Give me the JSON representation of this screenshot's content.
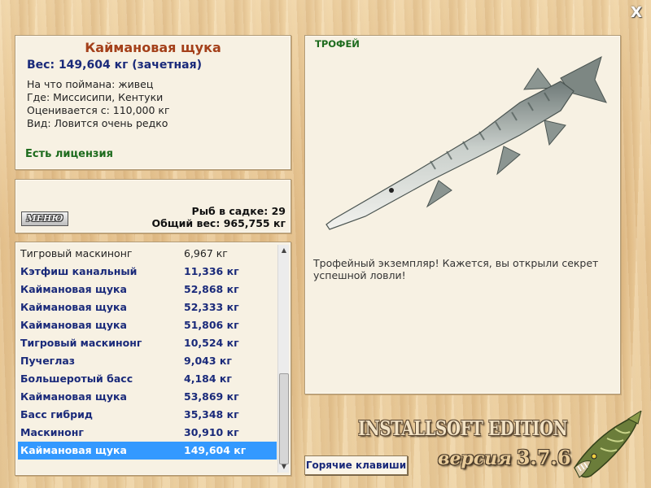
{
  "window": {
    "close_label": "X"
  },
  "fish_info": {
    "title": "Каймановая щука",
    "weight": "Вес: 149,604 кг (зачетная)",
    "bait": "На что поймана: живец",
    "location": "Где: Миссисипи, Кентуки",
    "valued_from": "Оценивается с: 110,000 кг",
    "rarity": "Вид: Ловится очень редко",
    "license": "Есть лицензия"
  },
  "menu_panel": {
    "menu_label": "МЕНЮ",
    "fish_in_cage": "Рыб в садке: 29",
    "total_weight": "Общий вес: 965,755 кг"
  },
  "catch_list": [
    {
      "name": "Тигровый маскинонг",
      "weight": "6,967 кг",
      "style": "plain"
    },
    {
      "name": "Кэтфиш канальный",
      "weight": "11,336 кг",
      "style": "bold"
    },
    {
      "name": "Каймановая щука",
      "weight": "52,868 кг",
      "style": "bold"
    },
    {
      "name": "Каймановая щука",
      "weight": "52,333 кг",
      "style": "bold"
    },
    {
      "name": "Каймановая щука",
      "weight": "51,806 кг",
      "style": "bold"
    },
    {
      "name": "Тигровый маскинонг",
      "weight": "10,524 кг",
      "style": "bold"
    },
    {
      "name": "Пучеглаз",
      "weight": "9,043 кг",
      "style": "bold"
    },
    {
      "name": "Большеротый басс",
      "weight": "4,184 кг",
      "style": "bold"
    },
    {
      "name": "Каймановая щука",
      "weight": "53,869 кг",
      "style": "bold"
    },
    {
      "name": "Басс гибрид",
      "weight": "35,348 кг",
      "style": "bold"
    },
    {
      "name": "Маскинонг",
      "weight": "30,910 кг",
      "style": "bold"
    },
    {
      "name": "Каймановая щука",
      "weight": "149,604 кг",
      "style": "selected"
    }
  ],
  "trophy": {
    "label": "ТРОФЕЙ",
    "description": "Трофейный экземпляр! Кажется, вы открыли секрет успешной ловли!"
  },
  "footer": {
    "hotkeys_label": "Горячие клавиши",
    "brand": "INSTALLSOFT EDITION",
    "version_word": "версия",
    "version_number": "3.7.6"
  },
  "colors": {
    "title": "#a4401a",
    "weight": "#1a2a7a",
    "license": "#1d6b1d",
    "selected_row": "#3399ff",
    "panel": "#f7f1e3"
  },
  "icons": {
    "close": "close-icon",
    "scroll_up": "arrow-up-icon",
    "scroll_down": "arrow-down-icon",
    "trophy_image": "gar-fish-image",
    "logo": "pike-logo-icon"
  }
}
